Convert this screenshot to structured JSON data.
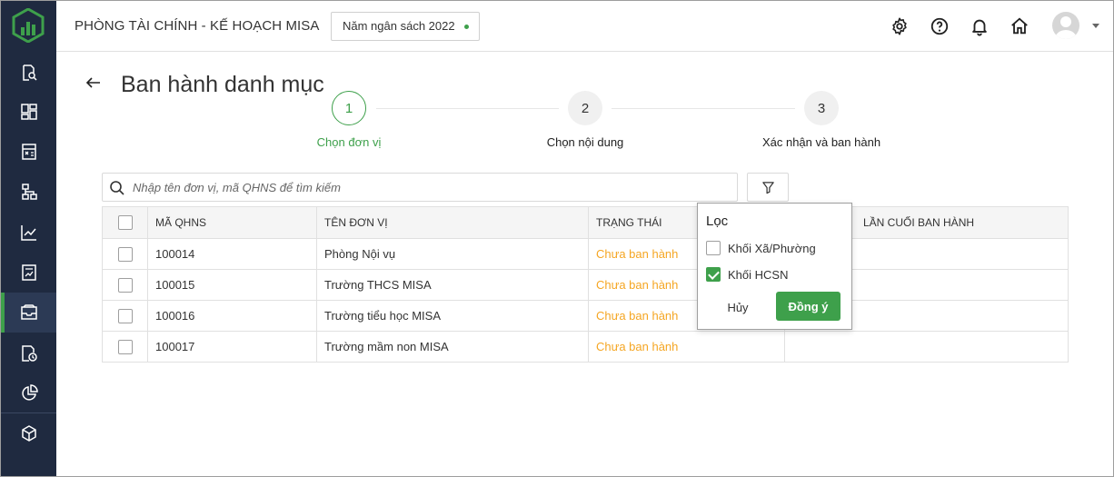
{
  "header": {
    "org_title": "PHÒNG TÀI CHÍNH - KẾ HOẠCH MISA",
    "budget_year": "Năm ngân sách 2022"
  },
  "sidebar": {
    "items": [
      {
        "icon": "search-document-icon"
      },
      {
        "icon": "dashboard-icon"
      },
      {
        "icon": "calculator-icon"
      },
      {
        "icon": "org-chart-icon"
      },
      {
        "icon": "line-chart-icon"
      },
      {
        "icon": "report-icon"
      },
      {
        "icon": "inbox-icon",
        "active": true
      },
      {
        "icon": "clock-document-icon"
      },
      {
        "icon": "pie-chart-icon"
      },
      {
        "icon": "cube-icon"
      }
    ]
  },
  "page": {
    "title": "Ban hành danh mục"
  },
  "steps": [
    {
      "number": "1",
      "label": "Chọn đơn vị",
      "active": true
    },
    {
      "number": "2",
      "label": "Chọn nội dung",
      "active": false
    },
    {
      "number": "3",
      "label": "Xác nhận và ban hành",
      "active": false
    }
  ],
  "search": {
    "placeholder": "Nhập tên đơn vị, mã QHNS để tìm kiếm",
    "value": ""
  },
  "table": {
    "columns": [
      "MÃ QHNS",
      "TÊN ĐƠN VỊ",
      "TRẠNG THÁI",
      "LẦN CUỐI BAN HÀNH"
    ],
    "rows": [
      {
        "code": "100014",
        "name": "Phòng Nội vụ",
        "status": "Chưa ban hành",
        "last": ""
      },
      {
        "code": "100015",
        "name": "Trường THCS MISA",
        "status": "Chưa ban hành",
        "last": ""
      },
      {
        "code": "100016",
        "name": "Trường tiểu học MISA",
        "status": "Chưa ban hành",
        "last": ""
      },
      {
        "code": "100017",
        "name": "Trường mầm non MISA",
        "status": "Chưa ban hành",
        "last": ""
      }
    ]
  },
  "filter_popup": {
    "title": "Lọc",
    "options": [
      {
        "label": "Khối Xã/Phường",
        "checked": false
      },
      {
        "label": "Khối HCSN",
        "checked": true
      }
    ],
    "cancel_label": "Hủy",
    "ok_label": "Đồng ý"
  },
  "colors": {
    "accent": "#3ea04b",
    "sidebar": "#1f2a40",
    "status_pending": "#f5a623"
  }
}
